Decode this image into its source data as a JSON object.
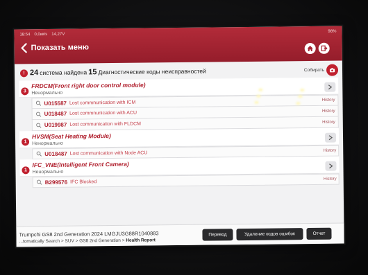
{
  "status_bar": {
    "time": "18:54",
    "net": "0,0кв/s",
    "voltage": "14,27V",
    "battery": "98%"
  },
  "header": {
    "title": "Показать меню"
  },
  "summary": {
    "systems_count": "24",
    "systems_text": "система найдена",
    "codes_count": "15",
    "codes_text": "Диагностические коды неисправностей",
    "collect_label": "Собирать"
  },
  "modules": [
    {
      "badge": "3",
      "name": "FRDCM(Front right door control module)",
      "status": "Ненормально",
      "dtcs": [
        {
          "code": "U015587",
          "desc": "Lost commnunication with ICM",
          "history": "History"
        },
        {
          "code": "U018487",
          "desc": "Lost commnunication with ACU",
          "history": "History"
        },
        {
          "code": "U019987",
          "desc": "Lost communication with FLDCM",
          "history": "History"
        }
      ]
    },
    {
      "badge": "1",
      "name": "HVSM(Seat Heating Module)",
      "status": "Ненормально",
      "history": "History",
      "dtcs": [
        {
          "code": "U018487",
          "desc": "Lost communication with Node ACU"
        }
      ]
    },
    {
      "badge": "1",
      "name": "IFC_VNE(Intelligent Front Camera)",
      "status": "Ненормально",
      "history": "History",
      "dtcs": [
        {
          "code": "B299576",
          "desc": "IFC Blocked"
        }
      ]
    }
  ],
  "bottom": {
    "vehicle": "Trumpchi  GS8 2nd Generation 2024  LMGJU3G88R1040883",
    "breadcrumb_prefix": "...tomatically Search > SUV > GS8 2nd Generation > ",
    "breadcrumb_current": "Health Report",
    "translate_label": "Перевод",
    "clear_codes_label": "Удаление кодов ошибок",
    "report_label": "Отчет"
  },
  "colors": {
    "header_red": "#a82433",
    "accent_red": "#c0202e",
    "dark_button": "#2a2a2c"
  }
}
